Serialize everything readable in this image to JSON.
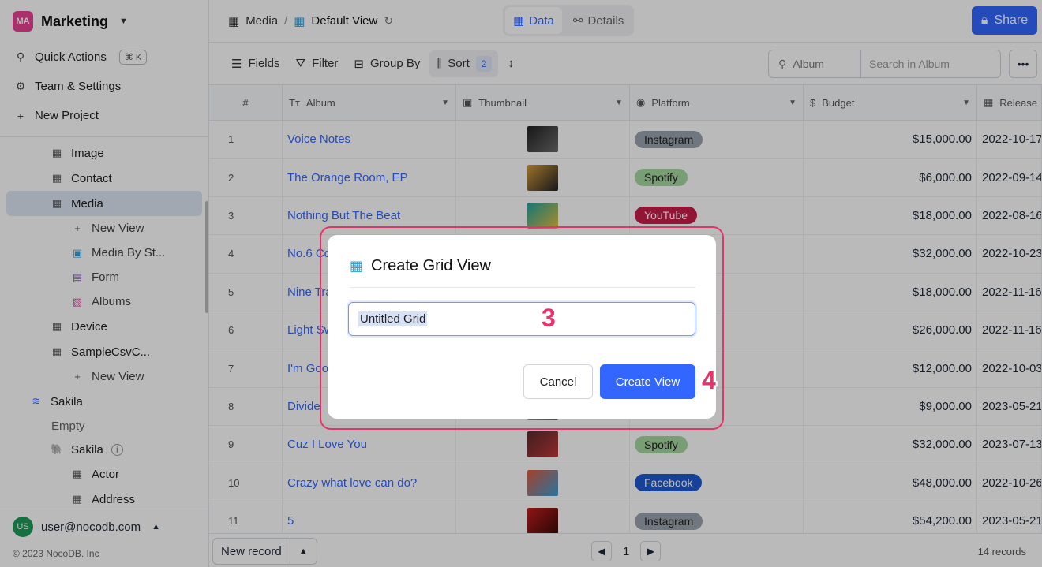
{
  "workspace": {
    "badge": "MA",
    "name": "Marketing",
    "badge_color": "#e84393"
  },
  "sidebar": {
    "actions": [
      {
        "label": "Quick Actions",
        "shortcut": "⌘ K",
        "icon": "search-icon"
      },
      {
        "label": "Team & Settings",
        "icon": "gear-icon"
      },
      {
        "label": "New Project",
        "icon": "plus-icon"
      }
    ],
    "tree": [
      {
        "label": "Image",
        "icon": "table-icon"
      },
      {
        "label": "Contact",
        "icon": "table-icon"
      },
      {
        "label": "Media",
        "icon": "table-icon",
        "active": true
      },
      {
        "label": "New View",
        "icon": "plus-icon"
      },
      {
        "label": "Media By St...",
        "icon": "gallery-icon"
      },
      {
        "label": "Form",
        "icon": "form-icon"
      },
      {
        "label": "Albums",
        "icon": "image-icon"
      },
      {
        "label": "Device",
        "icon": "table-icon"
      },
      {
        "label": "SampleCsvC...",
        "icon": "table-icon"
      },
      {
        "label": "New View",
        "icon": "plus-icon"
      },
      {
        "label": "Sakila",
        "icon": "database-icon"
      },
      {
        "label": "Empty",
        "icon": ""
      },
      {
        "label": "Sakila",
        "icon": "postgres-icon"
      },
      {
        "label": "Actor",
        "icon": "table-icon"
      },
      {
        "label": "Address",
        "icon": "table-icon"
      }
    ],
    "user": {
      "initials": "US",
      "email": "user@nocodb.com"
    },
    "copyright": "© 2023 NocoDB. Inc"
  },
  "topbar": {
    "breadcrumb_table": "Media",
    "breadcrumb_sep": "/",
    "breadcrumb_view": "Default View",
    "tabs": [
      {
        "label": "Data",
        "active": true
      },
      {
        "label": "Details",
        "active": false
      }
    ],
    "share_label": "Share"
  },
  "toolbar": {
    "fields": "Fields",
    "filter": "Filter",
    "group_by": "Group By",
    "sort": "Sort",
    "sort_count": "2",
    "search_field": "Album",
    "search_placeholder": "Search in Album"
  },
  "grid": {
    "columns": [
      "#",
      "Album",
      "Thumbnail",
      "Platform",
      "Budget",
      "Release"
    ],
    "rows": [
      {
        "n": "1",
        "album": "Voice Notes",
        "platform": "Instagram",
        "budget": "$15,000.00",
        "release": "2022-10-17"
      },
      {
        "n": "2",
        "album": "The Orange Room, EP",
        "platform": "Spotify",
        "budget": "$6,000.00",
        "release": "2022-09-14"
      },
      {
        "n": "3",
        "album": "Nothing But The Beat",
        "platform": "YouTube",
        "budget": "$18,000.00",
        "release": "2022-08-16"
      },
      {
        "n": "4",
        "album": "No.6 Collaborations",
        "platform": "",
        "budget": "$32,000.00",
        "release": "2022-10-23"
      },
      {
        "n": "5",
        "album": "Nine Track Mind",
        "platform": "",
        "budget": "$18,000.00",
        "release": "2022-11-16"
      },
      {
        "n": "6",
        "album": "Light Switch",
        "platform": "",
        "budget": "$26,000.00",
        "release": "2022-11-16"
      },
      {
        "n": "7",
        "album": "I'm Good",
        "platform": "",
        "budget": "$12,000.00",
        "release": "2022-10-03"
      },
      {
        "n": "8",
        "album": "Divide",
        "platform": "",
        "budget": "$9,000.00",
        "release": "2023-05-21"
      },
      {
        "n": "9",
        "album": "Cuz I Love You",
        "platform": "Spotify",
        "budget": "$32,000.00",
        "release": "2023-07-13"
      },
      {
        "n": "10",
        "album": "Crazy what love can do?",
        "platform": "Facebook",
        "budget": "$48,000.00",
        "release": "2022-10-26"
      },
      {
        "n": "11",
        "album": "5",
        "platform": "Instagram",
        "budget": "$54,200.00",
        "release": "2023-05-21"
      }
    ],
    "platform_colors": {
      "Instagram": "#9ca3af",
      "Spotify": "#a7d7a0",
      "YouTube": "#c81e4a",
      "Facebook": "#1e5bd1"
    }
  },
  "footer": {
    "new_record": "New record",
    "page": "1",
    "records": "14 records"
  },
  "modal": {
    "title": "Create Grid View",
    "input_value": "Untitled Grid",
    "cancel": "Cancel",
    "create": "Create View",
    "step_input": "3",
    "step_button": "4"
  }
}
